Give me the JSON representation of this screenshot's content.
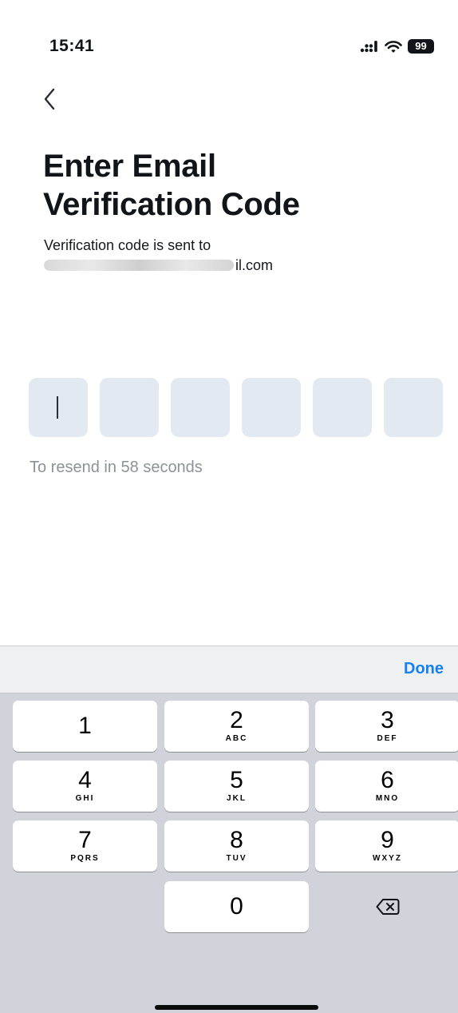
{
  "status_bar": {
    "time": "15:41",
    "battery": "99",
    "icons": [
      "cellular-signal-icon",
      "wifi-icon",
      "battery-icon"
    ]
  },
  "header": {
    "back_icon": "chevron-left-icon",
    "title_line1": "Enter Email",
    "title_line2": "Verification Code",
    "subtitle": "Verification code is sent to",
    "email_visible_suffix": "il.com"
  },
  "code_input": {
    "length": 6,
    "values": [
      "",
      "",
      "",
      "",
      "",
      ""
    ],
    "focused_index": 0
  },
  "resend_text": "To resend in 58 seconds",
  "keyboard": {
    "done_label": "Done",
    "keys": [
      {
        "digit": "1",
        "letters": ""
      },
      {
        "digit": "2",
        "letters": "ABC"
      },
      {
        "digit": "3",
        "letters": "DEF"
      },
      {
        "digit": "4",
        "letters": "GHI"
      },
      {
        "digit": "5",
        "letters": "JKL"
      },
      {
        "digit": "6",
        "letters": "MNO"
      },
      {
        "digit": "7",
        "letters": "PQRS"
      },
      {
        "digit": "8",
        "letters": "TUV"
      },
      {
        "digit": "9",
        "letters": "WXYZ"
      },
      {
        "digit": "0",
        "letters": ""
      }
    ],
    "delete_icon": "backspace-icon"
  },
  "colors": {
    "accent": "#1581f5",
    "code_box_bg": "#e3e9f0",
    "keyboard_bg": "#d0d4da",
    "muted_text": "#8d9298"
  }
}
